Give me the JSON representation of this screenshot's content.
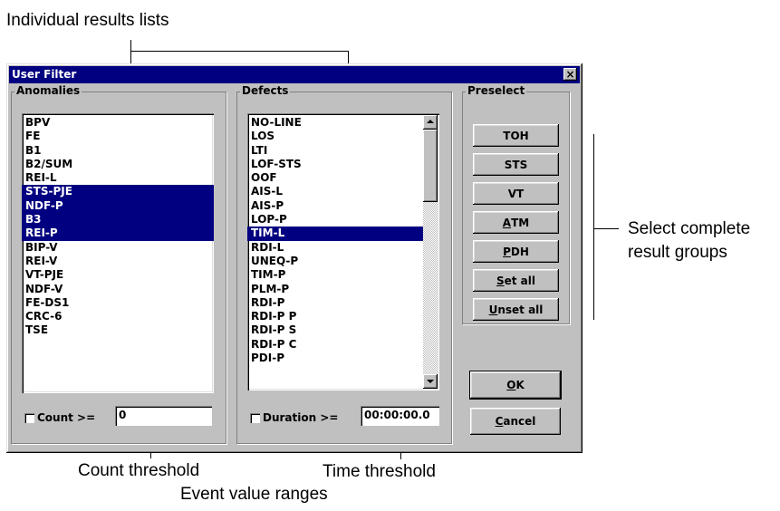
{
  "callouts": {
    "individual_lists": "Individual results lists",
    "select_groups_line1": "Select complete",
    "select_groups_line2": "result groups",
    "count_threshold": "Count threshold",
    "time_threshold": "Time threshold",
    "event_ranges": "Event value ranges"
  },
  "dialog": {
    "title": "User Filter",
    "close_glyph": "×",
    "anomalies": {
      "legend": "Anomalies",
      "items": [
        {
          "label": "BPV",
          "selected": false
        },
        {
          "label": "FE",
          "selected": false
        },
        {
          "label": "B1",
          "selected": false
        },
        {
          "label": "B2/SUM",
          "selected": false
        },
        {
          "label": "REI-L",
          "selected": false
        },
        {
          "label": "STS-PJE",
          "selected": true
        },
        {
          "label": "NDF-P",
          "selected": true
        },
        {
          "label": "B3",
          "selected": true
        },
        {
          "label": "REI-P",
          "selected": true
        },
        {
          "label": "BIP-V",
          "selected": false
        },
        {
          "label": "REI-V",
          "selected": false
        },
        {
          "label": "VT-PJE",
          "selected": false
        },
        {
          "label": "NDF-V",
          "selected": false
        },
        {
          "label": "FE-DS1",
          "selected": false
        },
        {
          "label": "CRC-6",
          "selected": false
        },
        {
          "label": "TSE",
          "selected": false
        }
      ],
      "count_label": "Count >=",
      "count_value": "0"
    },
    "defects": {
      "legend": "Defects",
      "items": [
        {
          "label": "NO-LINE",
          "selected": false
        },
        {
          "label": "LOS",
          "selected": false
        },
        {
          "label": "LTI",
          "selected": false
        },
        {
          "label": "LOF-STS",
          "selected": false
        },
        {
          "label": "OOF",
          "selected": false
        },
        {
          "label": "AIS-L",
          "selected": false
        },
        {
          "label": "AIS-P",
          "selected": false
        },
        {
          "label": "LOP-P",
          "selected": false
        },
        {
          "label": "TIM-L",
          "selected": true
        },
        {
          "label": "RDI-L",
          "selected": false
        },
        {
          "label": "UNEQ-P",
          "selected": false
        },
        {
          "label": "TIM-P",
          "selected": false
        },
        {
          "label": "PLM-P",
          "selected": false
        },
        {
          "label": "RDI-P",
          "selected": false
        },
        {
          "label": "RDI-P P",
          "selected": false
        },
        {
          "label": "RDI-P S",
          "selected": false
        },
        {
          "label": "RDI-P C",
          "selected": false
        },
        {
          "label": "PDI-P",
          "selected": false
        }
      ],
      "duration_label": "Duration >=",
      "duration_value": "00:00:00.0"
    },
    "preselect": {
      "legend": "Preselect",
      "toh": "TOH",
      "sts": "STS",
      "vt": "VT",
      "atm_mn": "A",
      "atm_rest": "TM",
      "pdh_mn": "P",
      "pdh_rest": "DH",
      "setall_mn": "S",
      "setall_rest": "et all",
      "unsetall_mn": "U",
      "unsetall_rest": "nset all"
    },
    "ok_mn": "O",
    "ok_rest": "K",
    "cancel_mn": "C",
    "cancel_rest": "ancel"
  }
}
